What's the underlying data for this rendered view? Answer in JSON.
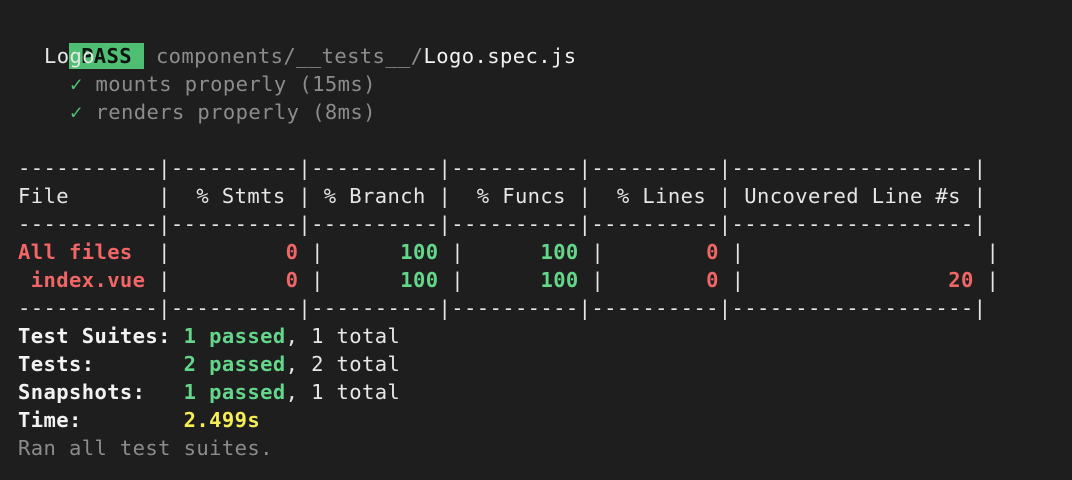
{
  "header": {
    "status": "PASS",
    "path_dir": "components/__tests__/",
    "path_file": "Logo.spec.js"
  },
  "suite": {
    "describe": "Logo",
    "tests": [
      {
        "check": "✓",
        "name": "mounts properly (15ms)"
      },
      {
        "check": "✓",
        "name": "renders properly (8ms)"
      }
    ]
  },
  "coverage": {
    "divider": "-----------|----------|----------|----------|----------|-------------------|",
    "header": "File       |  % Stmts | % Branch |  % Funcs |  % Lines | Uncovered Line #s |",
    "rows": [
      {
        "file": "All files ",
        "stmts": "0",
        "branch": "100",
        "funcs": "100",
        "lines": "0",
        "uncovered": ""
      },
      {
        "file": " index.vue",
        "stmts": "0",
        "branch": "100",
        "funcs": "100",
        "lines": "0",
        "uncovered": "20"
      }
    ]
  },
  "summary": {
    "suites_label": "Test Suites:",
    "suites_passed": "1 passed",
    "suites_total": ", 1 total",
    "tests_label": "Tests:",
    "tests_passed": "2 passed",
    "tests_total": ", 2 total",
    "snapshots_label": "Snapshots:",
    "snapshots_passed": "1 passed",
    "snapshots_total": ", 1 total",
    "time_label": "Time:",
    "time_value": "2.499s",
    "footer": "Ran all test suites."
  },
  "colors": {
    "background": "#1e1e1e",
    "pass": "#4fbf73",
    "uncovered": "#f06565",
    "covered": "#63d68a",
    "time": "#f7ee55"
  }
}
